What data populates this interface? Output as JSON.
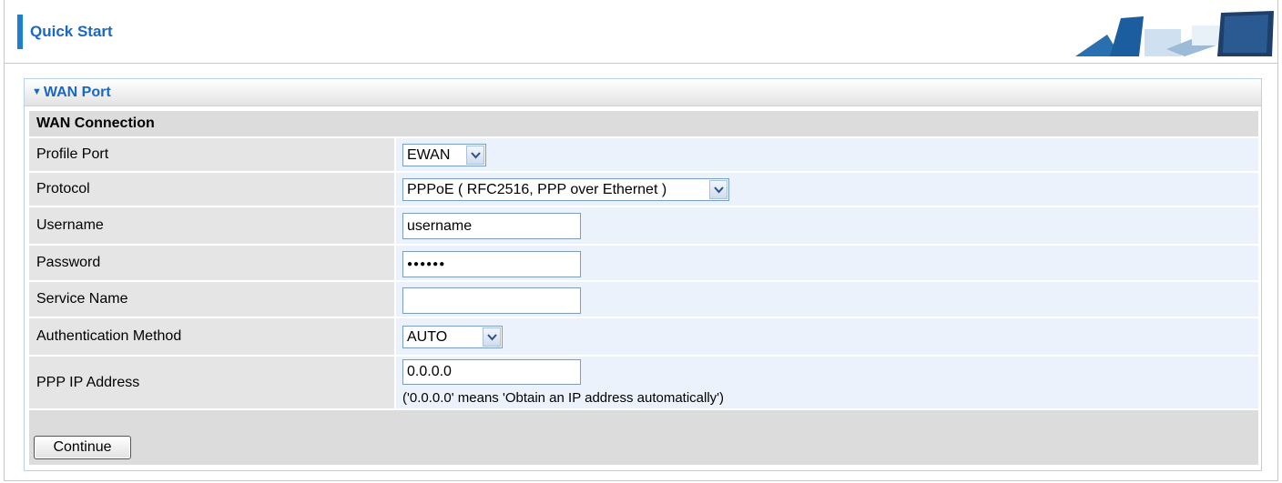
{
  "header": {
    "title": "Quick Start"
  },
  "panel": {
    "title": "WAN Port"
  },
  "section": {
    "title": "WAN Connection"
  },
  "fields": {
    "profile_port": {
      "label": "Profile Port",
      "value": "EWAN"
    },
    "protocol": {
      "label": "Protocol",
      "value": "PPPoE ( RFC2516, PPP over Ethernet )"
    },
    "username": {
      "label": "Username",
      "value": "username"
    },
    "password": {
      "label": "Password",
      "value": "●●●●●●"
    },
    "service_name": {
      "label": "Service Name",
      "value": ""
    },
    "auth_method": {
      "label": "Authentication Method",
      "value": "AUTO"
    },
    "ppp_ip": {
      "label": "PPP IP Address",
      "value": "0.0.0.0",
      "hint": "('0.0.0.0' means 'Obtain an IP address automatically')"
    }
  },
  "actions": {
    "continue_label": "Continue"
  },
  "colors": {
    "accent": "#1a67c4",
    "label_bg": "#e5e5e5",
    "value_bg": "#ebf2fb"
  }
}
